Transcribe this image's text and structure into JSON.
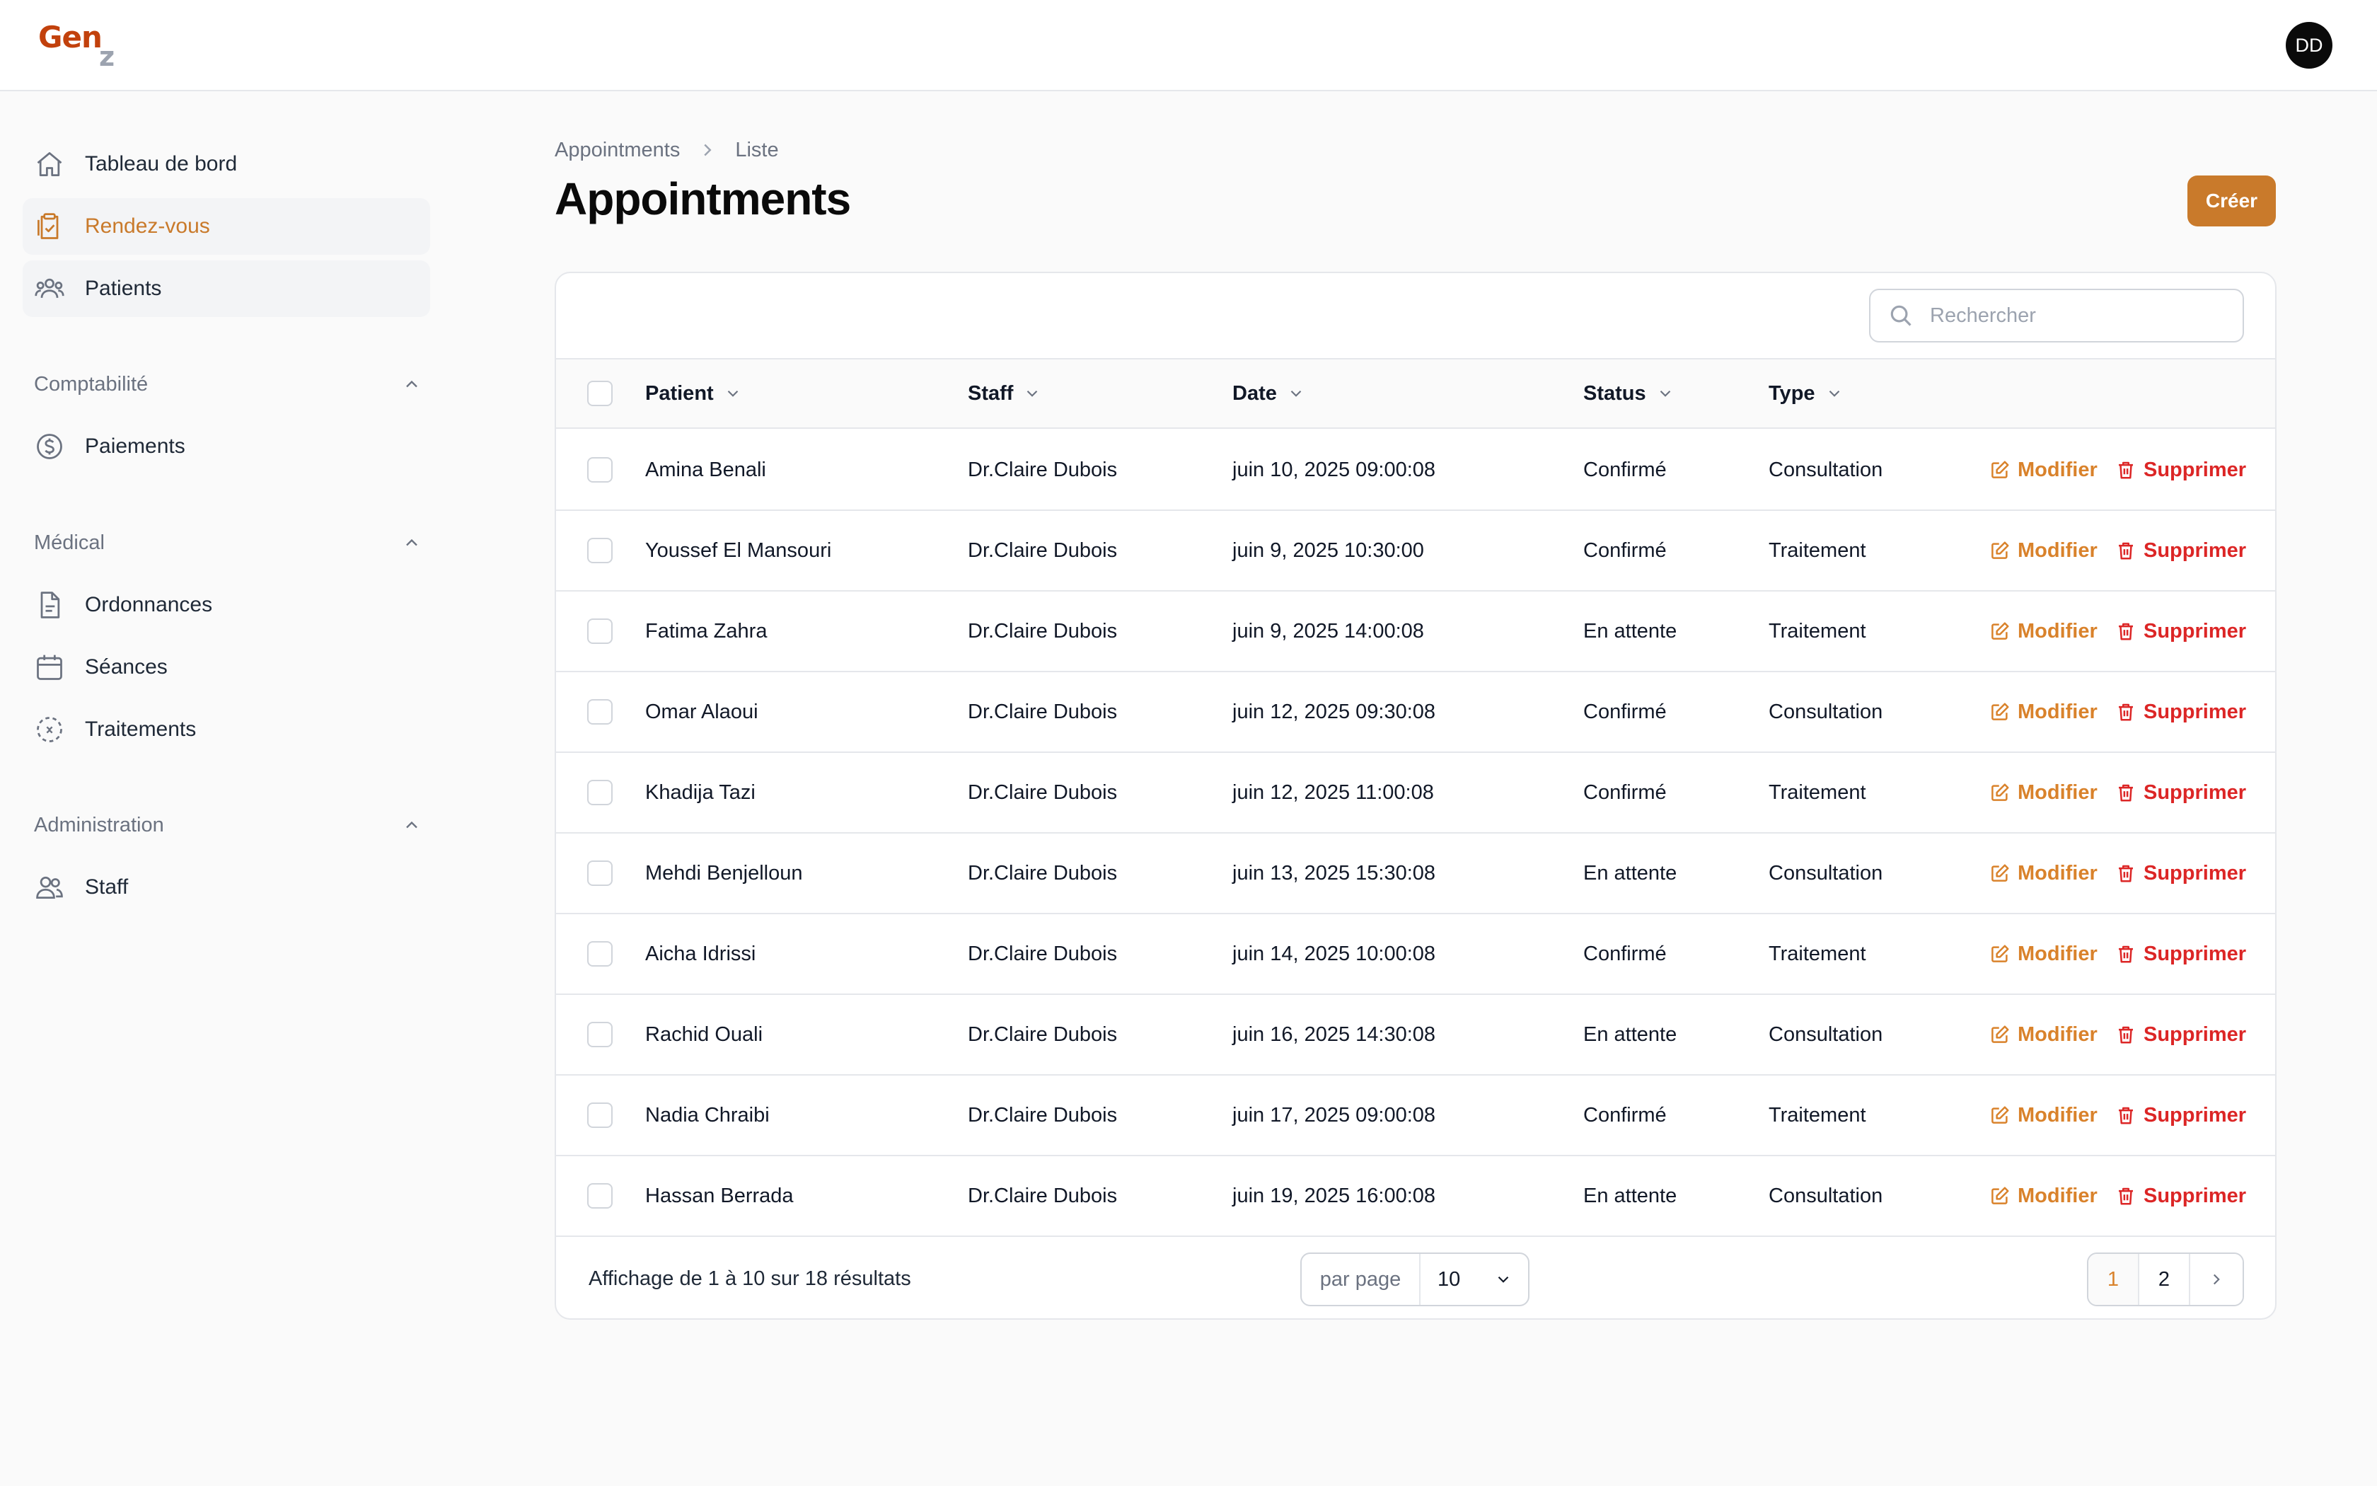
{
  "app": {
    "logo_main": "Gen",
    "logo_sub": "z",
    "avatar_initials": "DD"
  },
  "colors": {
    "accent": "#c97a2b",
    "accent_text": "#d9822b",
    "danger": "#dc2626",
    "logo": "#c2410c"
  },
  "sidebar": {
    "top_items": [
      {
        "label": "Tableau de bord",
        "icon": "home-icon"
      },
      {
        "label": "Rendez-vous",
        "icon": "clipboard-check-icon",
        "active": true
      },
      {
        "label": "Patients",
        "icon": "users-group-icon"
      }
    ],
    "groups": [
      {
        "label": "Comptabilité",
        "items": [
          {
            "label": "Paiements",
            "icon": "dollar-circle-icon"
          }
        ]
      },
      {
        "label": "Médical",
        "items": [
          {
            "label": "Ordonnances",
            "icon": "document-icon"
          },
          {
            "label": "Séances",
            "icon": "calendar-icon"
          },
          {
            "label": "Traitements",
            "icon": "dashed-circle-icon"
          }
        ]
      },
      {
        "label": "Administration",
        "items": [
          {
            "label": "Staff",
            "icon": "users-icon"
          }
        ]
      }
    ]
  },
  "breadcrumb": {
    "items": [
      "Appointments",
      "Liste"
    ]
  },
  "page": {
    "title": "Appointments",
    "create_label": "Créer"
  },
  "search": {
    "placeholder": "Rechercher"
  },
  "table": {
    "columns": [
      "Patient",
      "Staff",
      "Date",
      "Status",
      "Type"
    ],
    "edit_label": "Modifier",
    "delete_label": "Supprimer",
    "rows": [
      [
        "Amina Benali",
        "Dr.Claire Dubois",
        "juin 10, 2025 09:00:08",
        "Confirmé",
        "Consultation"
      ],
      [
        "Youssef El Mansouri",
        "Dr.Claire Dubois",
        "juin 9, 2025 10:30:00",
        "Confirmé",
        "Traitement"
      ],
      [
        "Fatima Zahra",
        "Dr.Claire Dubois",
        "juin 9, 2025 14:00:08",
        "En attente",
        "Traitement"
      ],
      [
        "Omar Alaoui",
        "Dr.Claire Dubois",
        "juin 12, 2025 09:30:08",
        "Confirmé",
        "Consultation"
      ],
      [
        "Khadija Tazi",
        "Dr.Claire Dubois",
        "juin 12, 2025 11:00:08",
        "Confirmé",
        "Traitement"
      ],
      [
        "Mehdi Benjelloun",
        "Dr.Claire Dubois",
        "juin 13, 2025 15:30:08",
        "En attente",
        "Consultation"
      ],
      [
        "Aicha Idrissi",
        "Dr.Claire Dubois",
        "juin 14, 2025 10:00:08",
        "Confirmé",
        "Traitement"
      ],
      [
        "Rachid Ouali",
        "Dr.Claire Dubois",
        "juin 16, 2025 14:30:08",
        "En attente",
        "Consultation"
      ],
      [
        "Nadia Chraibi",
        "Dr.Claire Dubois",
        "juin 17, 2025 09:00:08",
        "Confirmé",
        "Traitement"
      ],
      [
        "Hassan Berrada",
        "Dr.Claire Dubois",
        "juin 19, 2025 16:00:08",
        "En attente",
        "Consultation"
      ]
    ]
  },
  "footer": {
    "summary": "Affichage de 1 à 10 sur 18 résultats",
    "per_page_label": "par page",
    "per_page_value": "10",
    "pages": [
      "1",
      "2"
    ],
    "current_page": "1"
  }
}
